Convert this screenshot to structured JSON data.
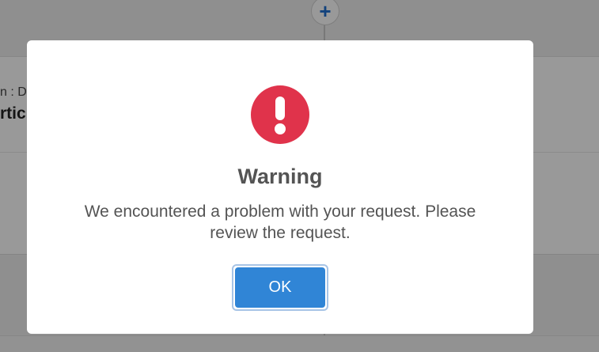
{
  "background": {
    "add_button_symbol": "+",
    "card_meta": "n : D",
    "card_title": "rticl"
  },
  "dialog": {
    "icon": "exclamation-icon",
    "title": "Warning",
    "message": "We encountered a problem with your request. Please review the request.",
    "ok_label": "OK"
  },
  "colors": {
    "icon_red": "#e0334b",
    "button_blue": "#3085d6",
    "add_button_blue": "#1f6fd1"
  }
}
